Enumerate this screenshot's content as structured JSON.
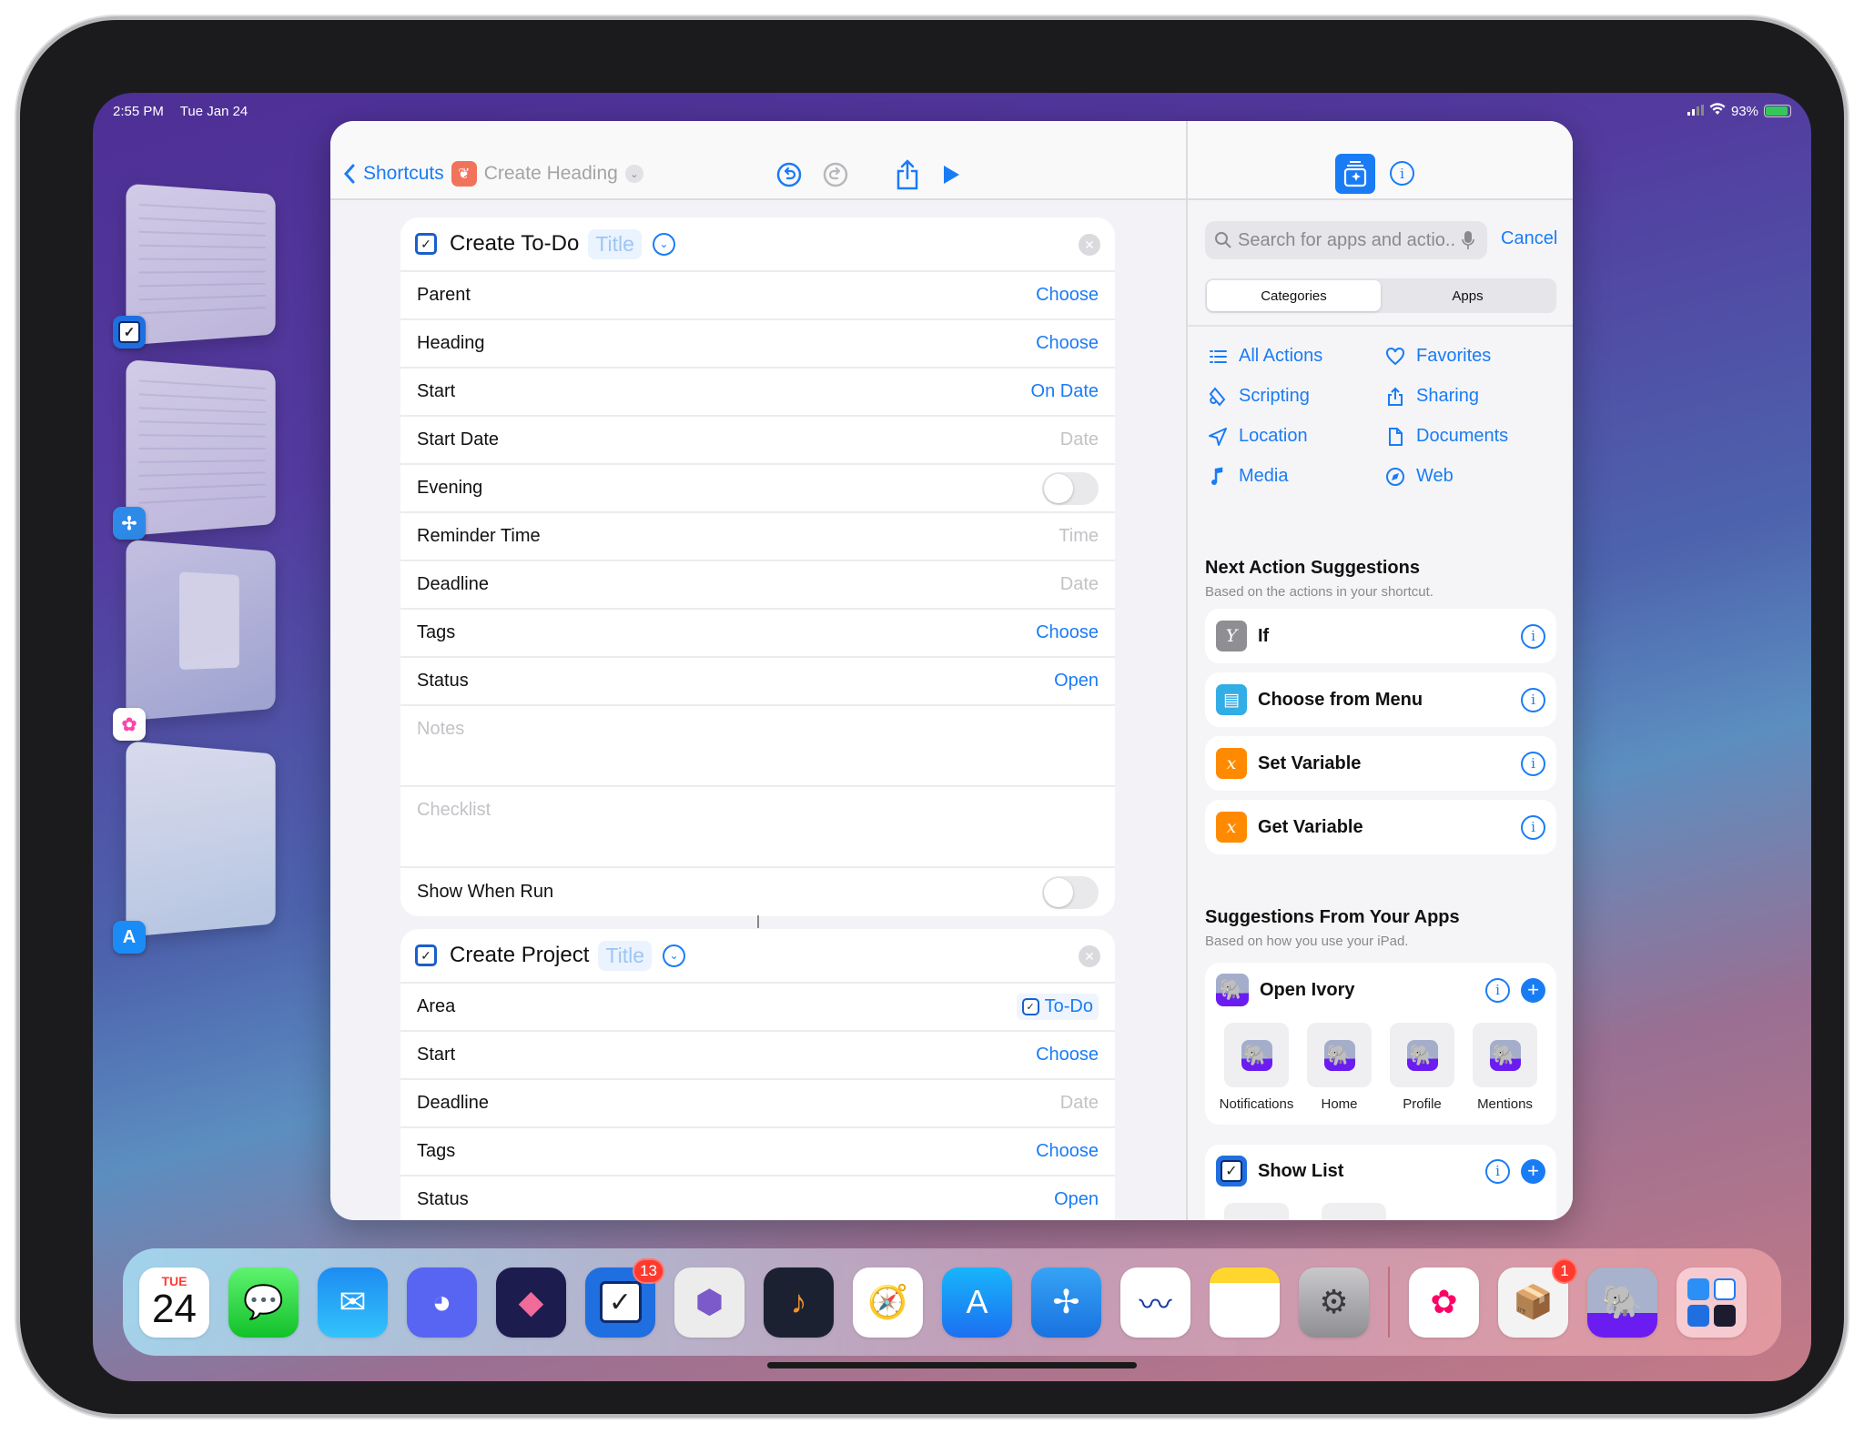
{
  "status_bar": {
    "time": "2:55 PM",
    "date": "Tue Jan 24",
    "battery": "93%"
  },
  "stage_manager": [
    {
      "app": "Things",
      "icon": "things-icon"
    },
    {
      "app": "TestFlight",
      "icon": "testflight-icon"
    },
    {
      "app": "Photos",
      "icon": "photos-icon"
    },
    {
      "app": "App Store",
      "icon": "app-store-icon"
    }
  ],
  "editor": {
    "back_label": "Shortcuts",
    "shortcut_name": "Create Heading",
    "cards": [
      {
        "title": "Create To-Do",
        "token": "Title",
        "rows": [
          {
            "label": "Parent",
            "value": "Choose",
            "kind": "link"
          },
          {
            "label": "Heading",
            "value": "Choose",
            "kind": "link"
          },
          {
            "label": "Start",
            "value": "On Date",
            "kind": "link"
          },
          {
            "label": "Start Date",
            "value": "Date",
            "kind": "placeholder"
          },
          {
            "label": "Evening",
            "value": "off",
            "kind": "toggle"
          },
          {
            "label": "Reminder Time",
            "value": "Time",
            "kind": "placeholder"
          },
          {
            "label": "Deadline",
            "value": "Date",
            "kind": "placeholder"
          },
          {
            "label": "Tags",
            "value": "Choose",
            "kind": "link"
          },
          {
            "label": "Status",
            "value": "Open",
            "kind": "link"
          }
        ],
        "notes_placeholder": "Notes",
        "checklist_placeholder": "Checklist",
        "show_when_run": "Show When Run"
      },
      {
        "title": "Create Project",
        "token": "Title",
        "area_label": "Area",
        "area_value": "To-Do",
        "rows": [
          {
            "label": "Start",
            "value": "Choose",
            "kind": "link"
          },
          {
            "label": "Deadline",
            "value": "Date",
            "kind": "placeholder"
          },
          {
            "label": "Tags",
            "value": "Choose",
            "kind": "link"
          },
          {
            "label": "Status",
            "value": "Open",
            "kind": "link"
          }
        ]
      }
    ]
  },
  "library": {
    "search_placeholder": "Search for apps and actio...",
    "cancel": "Cancel",
    "segments": [
      "Categories",
      "Apps"
    ],
    "selected_segment": "Categories",
    "categories": [
      {
        "label": "All Actions",
        "icon": "list-icon"
      },
      {
        "label": "Favorites",
        "icon": "heart-icon"
      },
      {
        "label": "Scripting",
        "icon": "scripting-icon"
      },
      {
        "label": "Sharing",
        "icon": "share-icon"
      },
      {
        "label": "Location",
        "icon": "location-icon"
      },
      {
        "label": "Documents",
        "icon": "document-icon"
      },
      {
        "label": "Media",
        "icon": "music-note-icon"
      },
      {
        "label": "Web",
        "icon": "compass-icon"
      }
    ],
    "next_title": "Next Action Suggestions",
    "next_sub": "Based on the actions in your shortcut.",
    "next_actions": [
      {
        "label": "If",
        "icon": "if-icon",
        "color": "#8e8e93",
        "glyph": "Y"
      },
      {
        "label": "Choose from Menu",
        "icon": "menu-icon",
        "color": "#32ade6",
        "glyph": "▤"
      },
      {
        "label": "Set Variable",
        "icon": "variable-icon",
        "color": "#ff8a00",
        "glyph": "x"
      },
      {
        "label": "Get Variable",
        "icon": "variable-icon",
        "color": "#ff8a00",
        "glyph": "x"
      }
    ],
    "apps_title": "Suggestions From Your Apps",
    "apps_sub": "Based on how you use your iPad.",
    "open_ivory": {
      "label": "Open Ivory",
      "tiles": [
        "Notifications",
        "Home",
        "Profile",
        "Mentions"
      ]
    },
    "show_list": {
      "label": "Show List"
    }
  },
  "dock": {
    "calendar": {
      "weekday": "TUE",
      "day": "24"
    },
    "apps": [
      {
        "name": "Calendar"
      },
      {
        "name": "Messages"
      },
      {
        "name": "Mail"
      },
      {
        "name": "Discord"
      },
      {
        "name": "Shortcuts"
      },
      {
        "name": "Things",
        "badge": "13"
      },
      {
        "name": "Obsidian"
      },
      {
        "name": "Music Player"
      },
      {
        "name": "Safari"
      },
      {
        "name": "App Store"
      },
      {
        "name": "TestFlight"
      },
      {
        "name": "Freeform"
      },
      {
        "name": "Notes"
      },
      {
        "name": "Settings"
      },
      {
        "name": "Photos"
      },
      {
        "name": "Deliveries",
        "badge": "1"
      },
      {
        "name": "Ivory"
      },
      {
        "name": "App Library"
      }
    ]
  }
}
